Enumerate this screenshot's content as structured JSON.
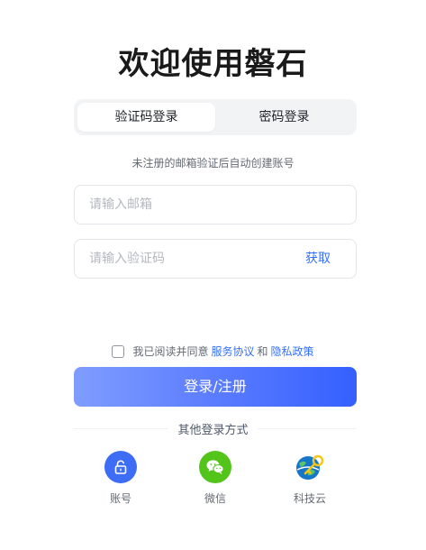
{
  "title": "欢迎使用磐石",
  "tabs": [
    {
      "label": "验证码登录",
      "active": true
    },
    {
      "label": "密码登录",
      "active": false
    }
  ],
  "hint": "未注册的邮箱验证后自动创建账号",
  "email": {
    "value": "",
    "placeholder": "请输入邮箱"
  },
  "code": {
    "value": "",
    "placeholder": "请输入验证码",
    "get_label": "获取"
  },
  "agreement": {
    "checked": false,
    "prefix": "我已阅读并同意",
    "service_link": "服务协议",
    "and": "和",
    "privacy_link": "隐私政策"
  },
  "submit_label": "登录/注册",
  "other_login": {
    "title": "其他登录方式",
    "providers": [
      {
        "label": "账号",
        "icon": "lock-icon",
        "color": "#3d6cf5"
      },
      {
        "label": "微信",
        "icon": "wechat-icon",
        "color": "#52c41a"
      },
      {
        "label": "科技云",
        "icon": "globe-key-icon",
        "color": "#1677c9"
      }
    ]
  },
  "colors": {
    "accent": "#3370ff",
    "button_start": "#7f9dff",
    "button_end": "#3560ff"
  }
}
